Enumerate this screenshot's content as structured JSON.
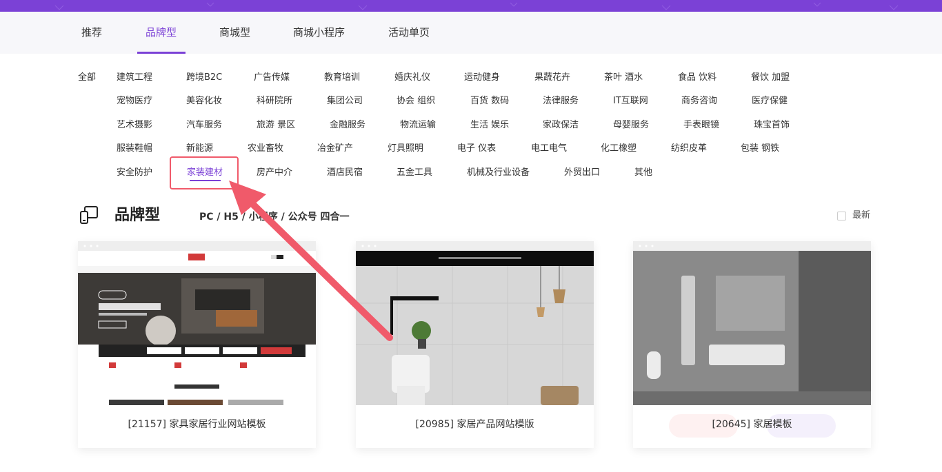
{
  "tabs": [
    {
      "label": "推荐"
    },
    {
      "label": "品牌型"
    },
    {
      "label": "商城型"
    },
    {
      "label": "商城小程序"
    },
    {
      "label": "活动单页"
    }
  ],
  "active_tab": "品牌型",
  "categories": {
    "all": "全部",
    "row1": [
      "建筑工程",
      "跨境B2C",
      "广告传媒",
      "教育培训",
      "婚庆礼仪",
      "运动健身",
      "果蔬花卉",
      "茶叶 酒水",
      "食品 饮料",
      "餐饮 加盟"
    ],
    "row2": [
      "宠物医疗",
      "美容化妆",
      "科研院所",
      "集团公司",
      "协会 组织",
      "百货 数码",
      "法律服务",
      "IT互联网",
      "商务咨询",
      "医疗保健"
    ],
    "row3": [
      "艺术摄影",
      "汽车服务",
      "旅游 景区",
      "金融服务",
      "物流运输",
      "生活 娱乐",
      "家政保洁",
      "母婴服务",
      "手表眼镜",
      "珠宝首饰"
    ],
    "row4": [
      "服装鞋帽",
      "新能源",
      "农业畜牧",
      "冶金矿产",
      "灯具照明",
      "电子 仪表",
      "电工电气",
      "化工橡塑",
      "纺织皮革",
      "包装 钢铁"
    ],
    "row5": [
      "安全防护",
      "家装建材",
      "房产中介",
      "酒店民宿",
      "五金工具",
      "机械及行业设备",
      "外贸出口",
      "其他"
    ]
  },
  "active_category": "家装建材",
  "section": {
    "title": "品牌型",
    "subtitle": "PC / H5 / 小程序 / 公众号 四合一",
    "newest_label": "最新"
  },
  "cards": [
    {
      "title": "[21157] 家具家居行业网站模板"
    },
    {
      "title": "[20985] 家居产品网站模版"
    },
    {
      "title": "[20645] 家居模板"
    }
  ],
  "colors": {
    "accent": "#7b41d6",
    "annotation": "#f05a6a"
  }
}
